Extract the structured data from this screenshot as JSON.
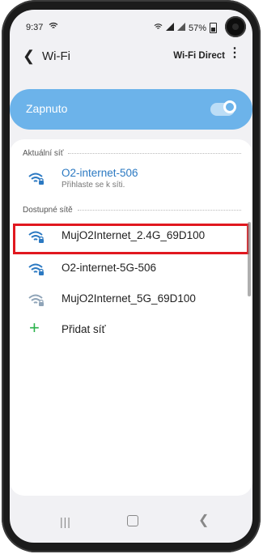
{
  "status_bar": {
    "time": "9:37",
    "battery": "57%"
  },
  "header": {
    "title": "Wi-Fi",
    "wifi_direct": "Wi-Fi Direct"
  },
  "toggle": {
    "label": "Zapnuto",
    "state": "on",
    "accent": "#6cb3ea"
  },
  "current_section": {
    "label": "Aktuální síť"
  },
  "current_network": {
    "name": "O2-internet-506",
    "status": "Přihlaste se k síti."
  },
  "available_section": {
    "label": "Dostupné sítě"
  },
  "available_networks": [
    {
      "name": "MujO2Internet_2.4G_69D100",
      "highlighted": true
    },
    {
      "name": "O2-internet-5G-506"
    },
    {
      "name": "MujO2Internet_5G_69D100"
    }
  ],
  "add_network": {
    "label": "Přidat síť"
  },
  "colors": {
    "highlight": "#e1181f",
    "link": "#2b79c2",
    "plus": "#2bb24c"
  }
}
